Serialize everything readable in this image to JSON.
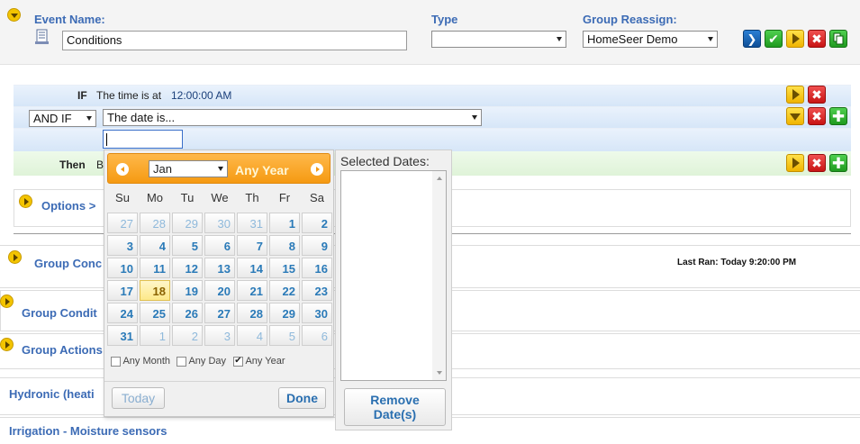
{
  "event": {
    "name_label": "Event Name:",
    "name_value": "Conditions",
    "type_label": "Type",
    "type_value": "",
    "group_label": "Group Reassign:",
    "group_value": "HomeSeer Demo"
  },
  "conditions": {
    "if_label": "IF",
    "if_text": "The time is at",
    "if_time": "12:00:00 AM",
    "andif_value": "AND IF",
    "andif_condition": "The date is...",
    "date_input_value": "",
    "then_label": "Then",
    "then_text": "B"
  },
  "options": {
    "label": "Options >"
  },
  "groups": [
    {
      "label": "Group Conc",
      "last_ran": "Last Ran: Today 9:20:00 PM"
    },
    {
      "label": "Group Condit"
    },
    {
      "label": "Group Actions"
    },
    {
      "label": "Hydronic (heati"
    },
    {
      "label": "Irrigation - Moisture sensors"
    }
  ],
  "calendar": {
    "month": "Jan",
    "year_label": "Any Year",
    "weekdays": [
      "Su",
      "Mo",
      "Tu",
      "We",
      "Th",
      "Fr",
      "Sa"
    ],
    "days": [
      {
        "d": "27",
        "other": true
      },
      {
        "d": "28",
        "other": true
      },
      {
        "d": "29",
        "other": true
      },
      {
        "d": "30",
        "other": true
      },
      {
        "d": "31",
        "other": true
      },
      {
        "d": "1"
      },
      {
        "d": "2"
      },
      {
        "d": "3"
      },
      {
        "d": "4"
      },
      {
        "d": "5"
      },
      {
        "d": "6"
      },
      {
        "d": "7"
      },
      {
        "d": "8"
      },
      {
        "d": "9"
      },
      {
        "d": "10"
      },
      {
        "d": "11"
      },
      {
        "d": "12"
      },
      {
        "d": "13"
      },
      {
        "d": "14"
      },
      {
        "d": "15"
      },
      {
        "d": "16"
      },
      {
        "d": "17"
      },
      {
        "d": "18",
        "today": true
      },
      {
        "d": "19"
      },
      {
        "d": "20"
      },
      {
        "d": "21"
      },
      {
        "d": "22"
      },
      {
        "d": "23"
      },
      {
        "d": "24"
      },
      {
        "d": "25"
      },
      {
        "d": "26"
      },
      {
        "d": "27"
      },
      {
        "d": "28"
      },
      {
        "d": "29"
      },
      {
        "d": "30"
      },
      {
        "d": "31"
      },
      {
        "d": "1",
        "other": true
      },
      {
        "d": "2",
        "other": true
      },
      {
        "d": "3",
        "other": true
      },
      {
        "d": "4",
        "other": true
      },
      {
        "d": "5",
        "other": true
      },
      {
        "d": "6",
        "other": true
      }
    ],
    "any_month_label": "Any Month",
    "any_month_checked": false,
    "any_day_label": "Any Day",
    "any_day_checked": false,
    "any_year_label": "Any Year",
    "any_year_checked": true,
    "today_label": "Today",
    "done_label": "Done"
  },
  "selected_dates": {
    "label": "Selected Dates:",
    "remove_label_1": "Remove",
    "remove_label_2": "Date(s)"
  },
  "colors": {
    "link_blue": "#3c6bb5",
    "calendar_header": "#f59a12",
    "day_text": "#2a7ab8"
  }
}
